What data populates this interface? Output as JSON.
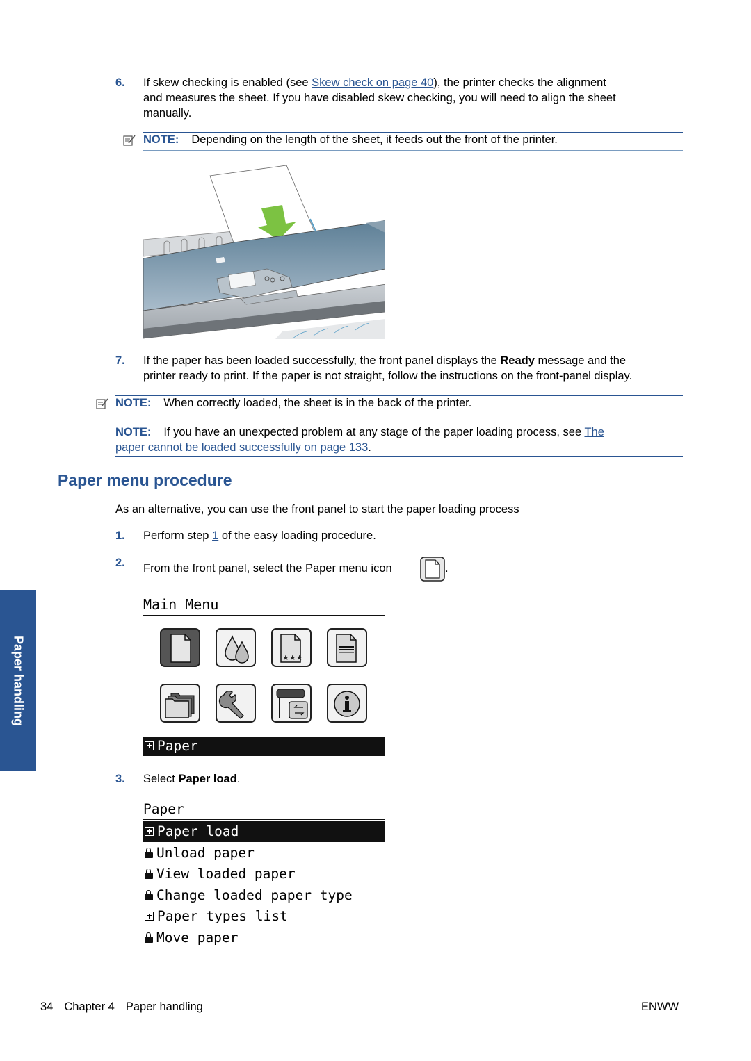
{
  "step6": {
    "number": "6.",
    "text_before_link": "If skew checking is enabled (see ",
    "link": "Skew check on page 40",
    "text_after_link": "), the printer checks the alignment",
    "line2": "and measures the sheet. If you have disabled skew checking, you will need to align the sheet",
    "line3": "manually."
  },
  "note1": {
    "label": "NOTE:",
    "text": "Depending on the length of the sheet, it feeds out the front of the printer."
  },
  "step7": {
    "number": "7.",
    "line1_before": "If the paper has been loaded successfully, the front panel displays the ",
    "line1_bold": "Ready",
    "line1_after": " message and the",
    "line2": "printer ready to print. If the paper is not straight, follow the instructions on the front-panel display."
  },
  "note2": {
    "label": "NOTE:",
    "text": "When correctly loaded, the sheet is in the back of the printer."
  },
  "note3": {
    "label": "NOTE:",
    "text": "If you have an unexpected problem at any stage of the paper loading process, see ",
    "link_part1": "The",
    "link_part2": "paper cannot be loaded successfully on page 133",
    "after": "."
  },
  "section": {
    "heading": "Paper menu procedure",
    "intro": "As an alternative, you can use the front panel to start the paper loading process"
  },
  "steps": [
    {
      "number": "1.",
      "before": "Perform step ",
      "link": "1",
      "after": " of the easy loading procedure."
    },
    {
      "number": "2.",
      "text": "From the front panel, select the Paper menu icon",
      "after": "."
    },
    {
      "number": "3.",
      "before": "Select ",
      "bold": "Paper load",
      "after": "."
    }
  ],
  "main_menu": {
    "title": "Main Menu",
    "icons": [
      "paper-icon",
      "ink-icon",
      "image-quality-icon",
      "job-queue-icon",
      "folder-icon",
      "wrench-icon",
      "printer-connectivity-icon",
      "info-icon"
    ],
    "selected_label": "Paper"
  },
  "paper_menu": {
    "title": "Paper",
    "items": [
      {
        "label": "Paper load",
        "icon": "expand",
        "selected": true
      },
      {
        "label": "Unload paper",
        "icon": "lock"
      },
      {
        "label": "View loaded paper",
        "icon": "lock"
      },
      {
        "label": "Change loaded paper type",
        "icon": "lock"
      },
      {
        "label": "Paper types list",
        "icon": "expand"
      },
      {
        "label": "Move paper",
        "icon": "lock"
      }
    ]
  },
  "side_tab": "Paper handling",
  "footer": {
    "page": "34",
    "chapter": "Chapter 4",
    "chapter_title": "Paper handling",
    "right": "ENWW"
  },
  "colors": {
    "accent": "#2a5592",
    "arrow": "#7cc242"
  }
}
